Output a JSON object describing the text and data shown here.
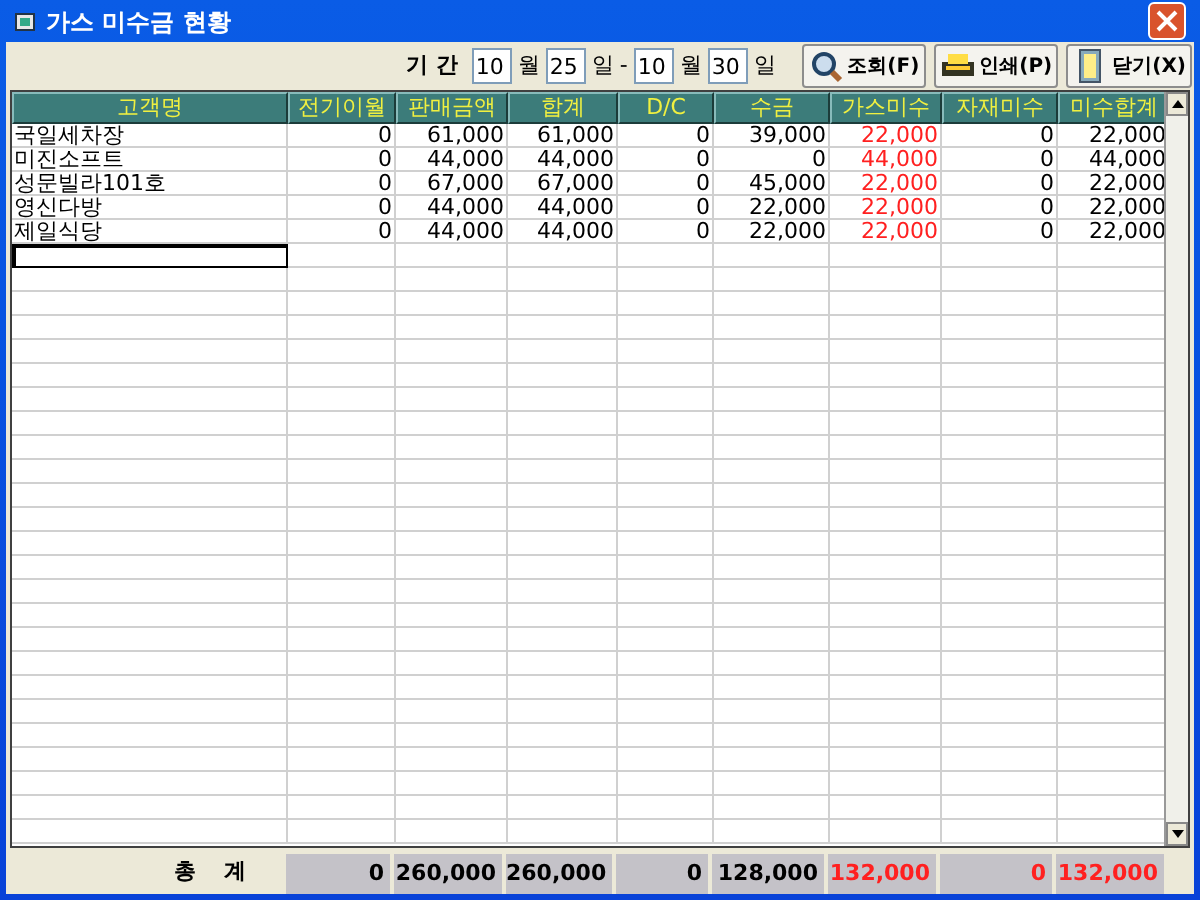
{
  "window": {
    "title": "가스 미수금 현황"
  },
  "period": {
    "label": "기 간",
    "from_month": "10",
    "month_unit_1": "월",
    "from_day": "25",
    "day_unit_1": "일",
    "separator": "-",
    "to_month": "10",
    "month_unit_2": "월",
    "to_day": "30",
    "day_unit_2": "일"
  },
  "buttons": [
    {
      "kind": "search",
      "label": "조회(F)"
    },
    {
      "kind": "print",
      "label": "인쇄(P)"
    },
    {
      "kind": "close",
      "label": "닫기(X)"
    }
  ],
  "table": {
    "columns": [
      {
        "label": "고객명",
        "alert": false
      },
      {
        "label": "전기이월",
        "alert": false
      },
      {
        "label": "판매금액",
        "alert": false
      },
      {
        "label": "합계",
        "alert": false
      },
      {
        "label": "D/C",
        "alert": false
      },
      {
        "label": "수금",
        "alert": false
      },
      {
        "label": "가스미수",
        "alert": true
      },
      {
        "label": "자재미수",
        "alert": false
      },
      {
        "label": "미수합계",
        "alert": false
      }
    ],
    "rows": [
      [
        "국일세차장",
        "0",
        "61,000",
        "61,000",
        "0",
        "39,000",
        "22,000",
        "0",
        "22,000"
      ],
      [
        "미진소프트",
        "0",
        "44,000",
        "44,000",
        "0",
        "0",
        "44,000",
        "0",
        "44,000"
      ],
      [
        "성문빌라101호",
        "0",
        "67,000",
        "67,000",
        "0",
        "45,000",
        "22,000",
        "0",
        "22,000"
      ],
      [
        "영신다방",
        "0",
        "44,000",
        "44,000",
        "0",
        "22,000",
        "22,000",
        "0",
        "22,000"
      ],
      [
        "제일식당",
        "0",
        "44,000",
        "44,000",
        "0",
        "22,000",
        "22,000",
        "0",
        "22,000"
      ]
    ],
    "new_row_focused": true
  },
  "totals": {
    "label": "총 계",
    "values": [
      {
        "text": "0",
        "alert": false
      },
      {
        "text": "260,000",
        "alert": false
      },
      {
        "text": "260,000",
        "alert": false
      },
      {
        "text": "0",
        "alert": false
      },
      {
        "text": "128,000",
        "alert": false
      },
      {
        "text": "132,000",
        "alert": true
      },
      {
        "text": "0",
        "alert": true
      },
      {
        "text": "132,000",
        "alert": true
      }
    ]
  }
}
